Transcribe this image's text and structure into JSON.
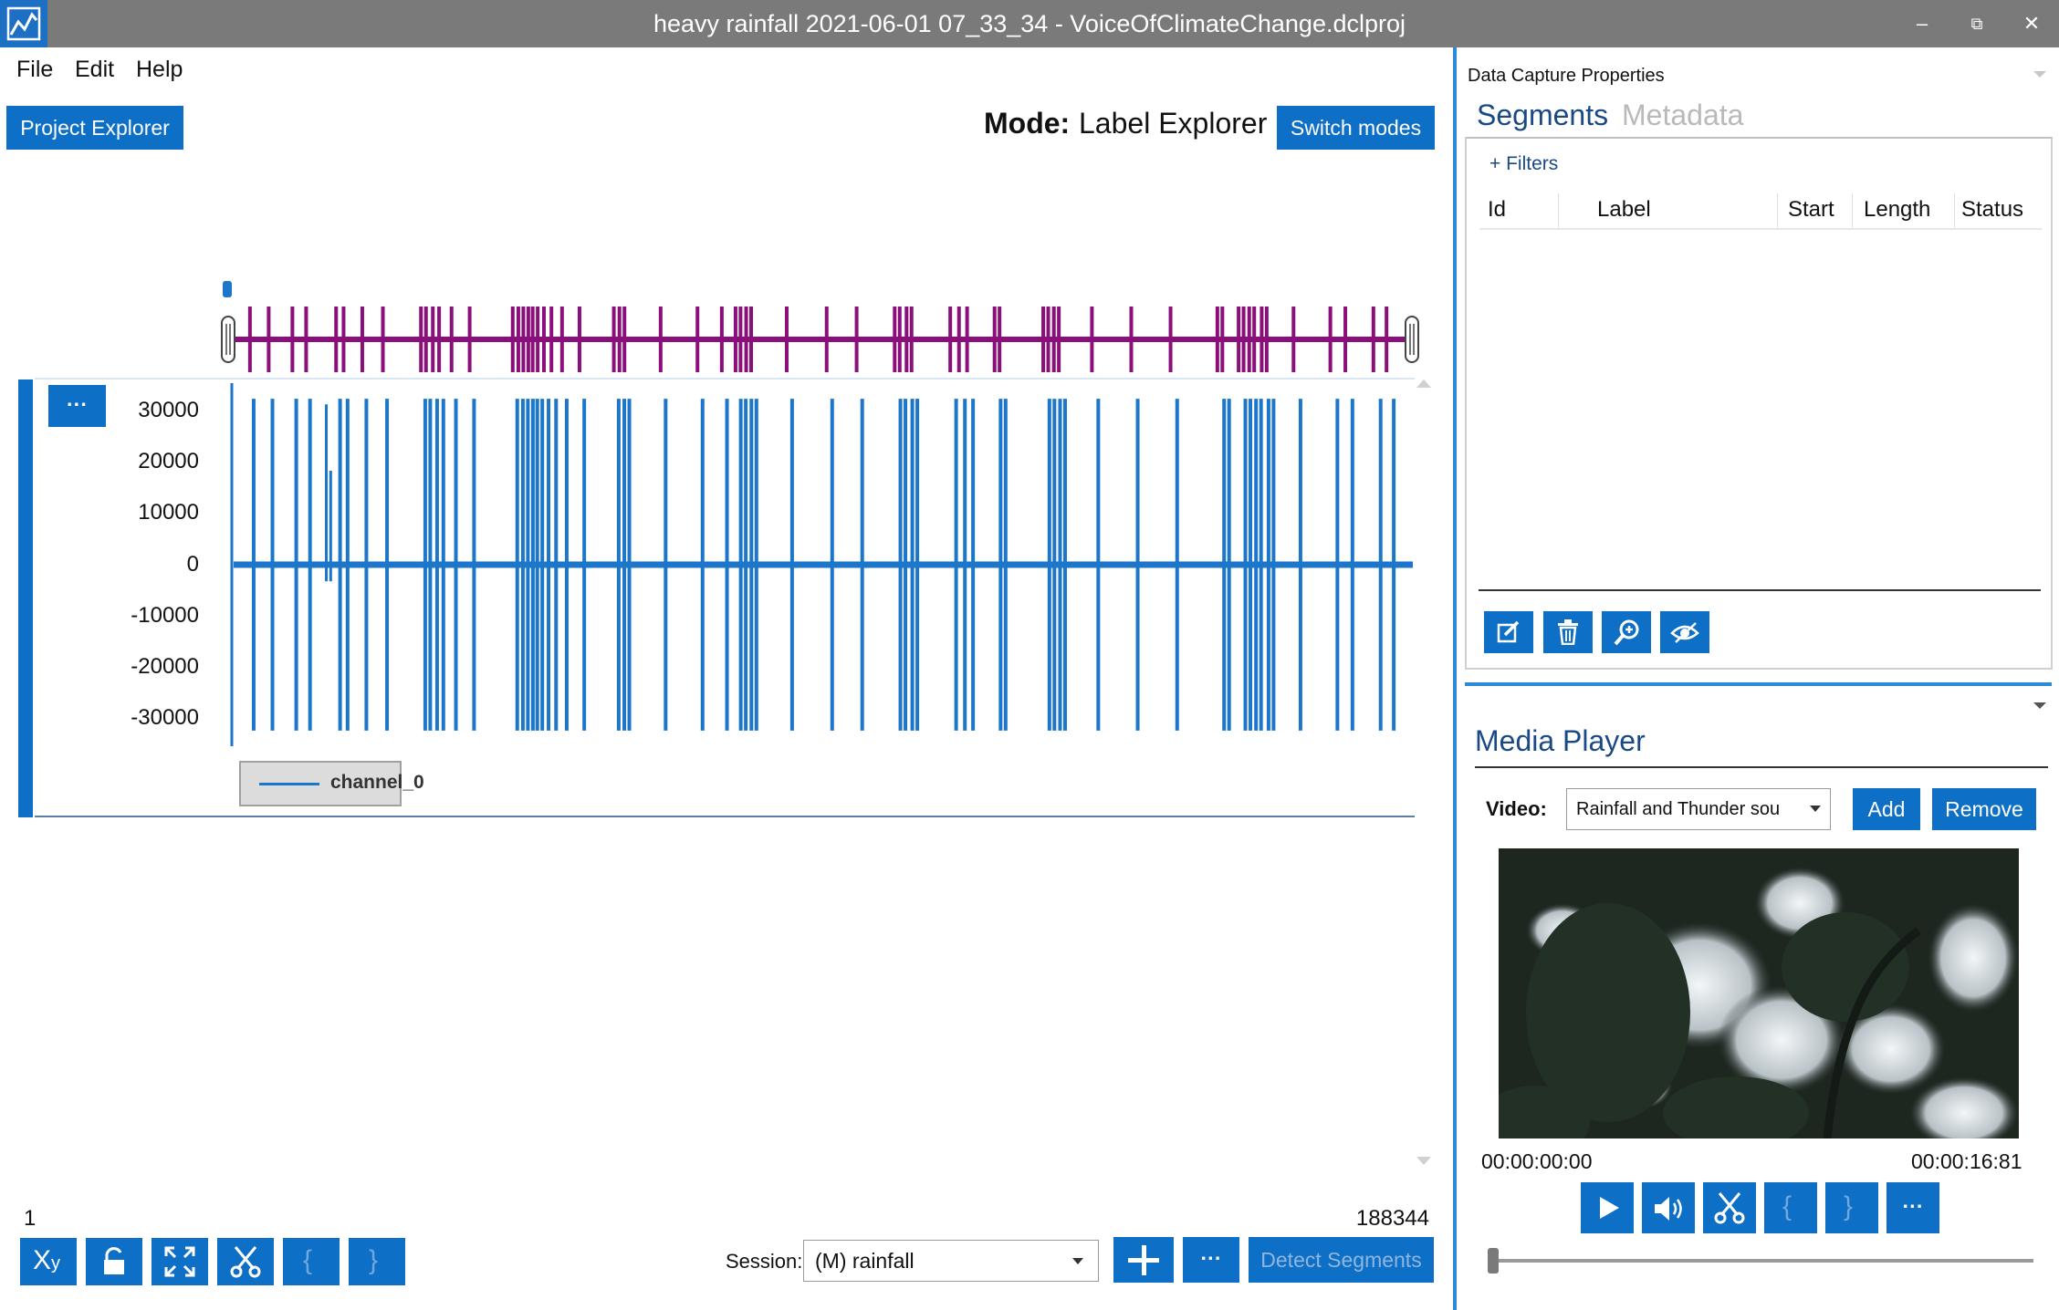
{
  "window": {
    "title": "heavy rainfall 2021-06-01 07_33_34 - VoiceOfClimateChange.dclproj",
    "minimize_glyph": "–",
    "restore_glyph": "⧉",
    "close_glyph": "✕"
  },
  "menu": [
    "File",
    "Edit",
    "Help"
  ],
  "toolbar": {
    "project_explorer": "Project Explorer",
    "mode_label": "Mode:",
    "mode_value": "Label Explorer",
    "switch_modes": "Switch modes"
  },
  "graph": {
    "menu_button": "···",
    "legend_label": "channel_0",
    "series_color": "#1c76c9",
    "overview_color": "#8b0f7b",
    "range_start": "1",
    "range_end": "188344"
  },
  "chart_data": {
    "type": "line",
    "series": [
      {
        "name": "channel_0"
      }
    ],
    "y_ticks": [
      "30000",
      "20000",
      "10000",
      "0",
      "-10000",
      "-20000",
      "-30000"
    ],
    "ylim": [
      -32000,
      32000
    ],
    "xlim": [
      1,
      188344
    ],
    "burst_x": [
      3200,
      6200,
      10000,
      12200,
      17000,
      18200,
      21200,
      24500,
      30600,
      31400,
      32500,
      33500,
      35500,
      38400,
      45300,
      46200,
      47000,
      47800,
      48500,
      49300,
      50300,
      51500,
      53200,
      56000,
      61500,
      62400,
      63200,
      69000,
      74900,
      78800,
      81000,
      81800,
      82700,
      83500,
      89200,
      95600,
      100400,
      106500,
      107300,
      108400,
      109200,
      115400,
      116800,
      118100,
      122500,
      123300,
      130300,
      131100,
      132000,
      132800,
      138100,
      144400,
      150700,
      158200,
      159000,
      161600,
      162400,
      163300,
      164100,
      165300,
      166100,
      170400,
      176300,
      178700,
      183200,
      185300
    ],
    "spikes": [
      {
        "x": 10000,
        "y": 22000
      },
      {
        "x": 14800,
        "y": 29000
      },
      {
        "x": 14800,
        "y": -3000
      },
      {
        "x": 15500,
        "y": 17000
      },
      {
        "x": 15500,
        "y": -3000
      }
    ]
  },
  "bottom_bar": {
    "session_label": "Session:",
    "session_value": "(M) rainfall",
    "detect_segments": "Detect Segments",
    "more": "···"
  },
  "right_panel": {
    "title": "Data Capture Properties",
    "tabs": [
      "Segments",
      "Metadata"
    ],
    "filters": "+ Filters",
    "columns": [
      "Id",
      "Label",
      "Start",
      "Length",
      "Status"
    ]
  },
  "media_player": {
    "title": "Media Player",
    "video_label": "Video:",
    "video_value": "Rainfall and Thunder sou",
    "add": "Add",
    "remove": "Remove",
    "time_start": "00:00:00:00",
    "time_end": "00:00:16:81",
    "position": 0,
    "more": "···"
  }
}
